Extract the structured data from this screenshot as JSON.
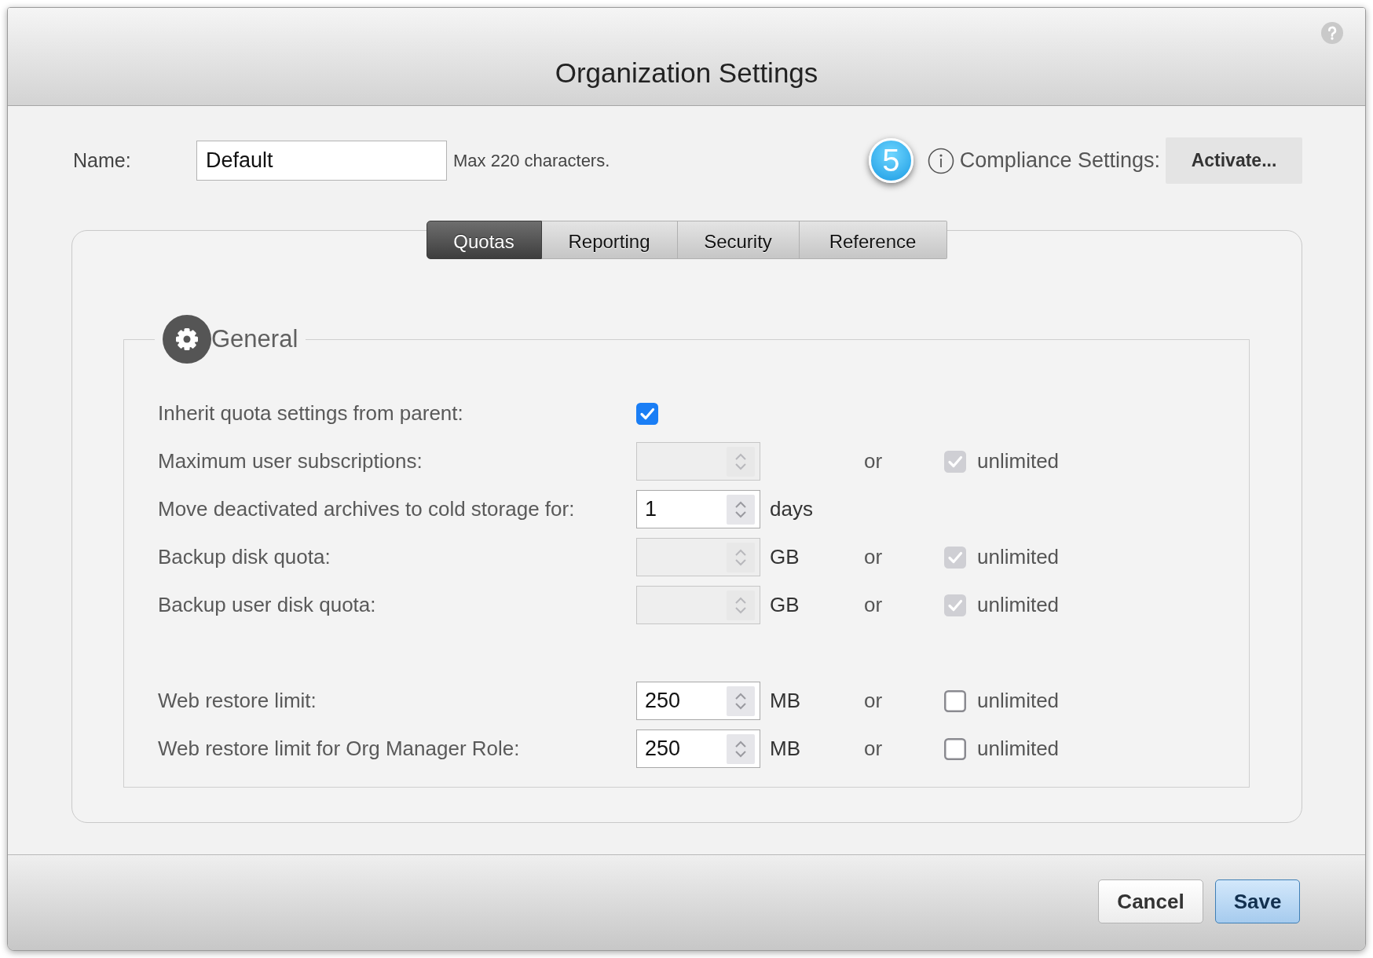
{
  "window": {
    "title": "Organization Settings"
  },
  "name_field": {
    "label": "Name:",
    "value": "Default",
    "hint": "Max 220 characters."
  },
  "compliance": {
    "step_badge": "5",
    "label": "Compliance Settings:",
    "button": "Activate..."
  },
  "tabs": [
    {
      "label": "Quotas",
      "selected": true
    },
    {
      "label": "Reporting",
      "selected": false
    },
    {
      "label": "Security",
      "selected": false
    },
    {
      "label": "Reference",
      "selected": false
    }
  ],
  "section": {
    "title": "General",
    "groups": [
      {
        "rows": [
          {
            "kind": "checkbox",
            "label": "Inherit quota settings from parent:",
            "checked": true
          },
          {
            "kind": "number",
            "label": "Maximum user subscriptions:",
            "disabled": true,
            "unlimited": {
              "separator": "or",
              "label": "unlimited",
              "checked": true,
              "disabled": true
            }
          },
          {
            "kind": "number",
            "label": "Move deactivated archives to cold storage for:",
            "value": "1",
            "disabled": false,
            "unit": "days"
          },
          {
            "kind": "number",
            "label": "Backup disk quota:",
            "disabled": true,
            "unit": "GB",
            "unlimited": {
              "separator": "or",
              "label": "unlimited",
              "checked": true,
              "disabled": true
            }
          },
          {
            "kind": "number",
            "label": "Backup user disk quota:",
            "disabled": true,
            "unit": "GB",
            "unlimited": {
              "separator": "or",
              "label": "unlimited",
              "checked": true,
              "disabled": true
            }
          }
        ]
      },
      {
        "rows": [
          {
            "kind": "number",
            "label": "Web restore limit:",
            "value": "250",
            "disabled": false,
            "unit": "MB",
            "unlimited": {
              "separator": "or",
              "label": "unlimited",
              "checked": false,
              "disabled": false
            }
          },
          {
            "kind": "number",
            "label": "Web restore limit for Org Manager Role:",
            "value": "250",
            "disabled": false,
            "unit": "MB",
            "unlimited": {
              "separator": "or",
              "label": "unlimited",
              "checked": false,
              "disabled": false
            }
          }
        ]
      }
    ]
  },
  "buttons": [
    {
      "label": "Cancel",
      "kind": "default"
    },
    {
      "label": "Save",
      "kind": "primary"
    }
  ]
}
